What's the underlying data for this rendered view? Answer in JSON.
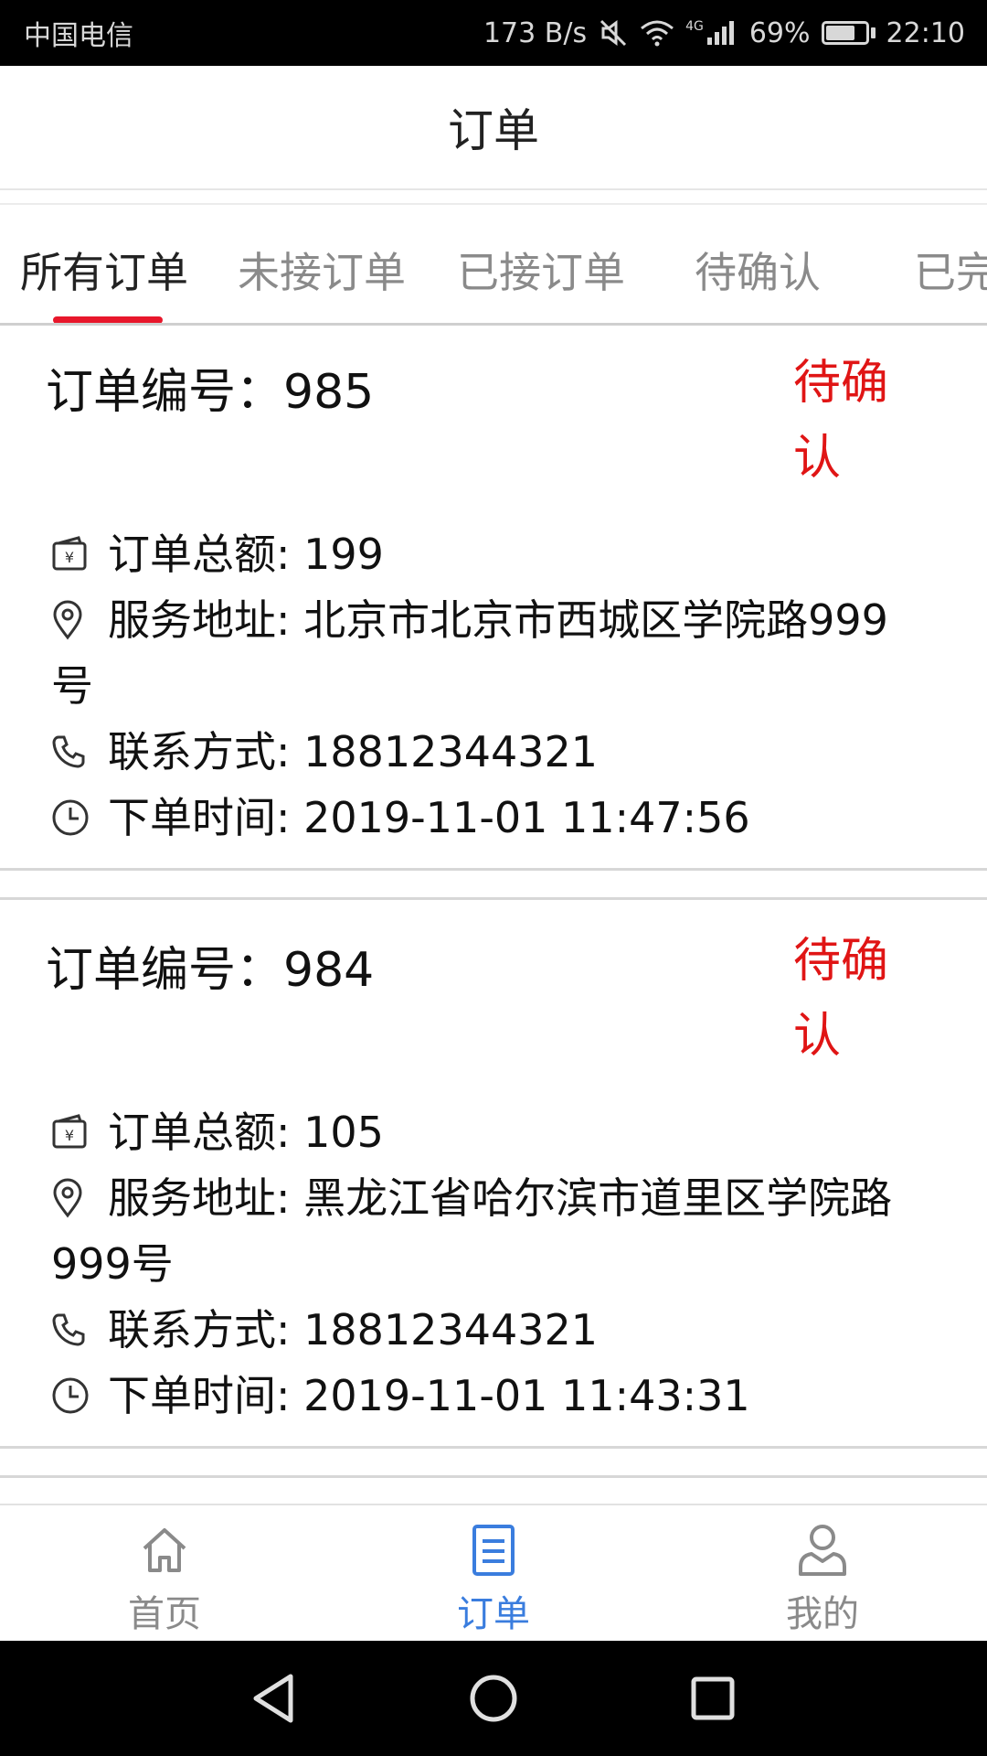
{
  "status_bar": {
    "carrier": "中国电信",
    "net_speed": "173 B/s",
    "network_type": "4G",
    "battery": "69%",
    "time": "22:10"
  },
  "header": {
    "title": "订单"
  },
  "tabs": [
    {
      "label": "所有订单",
      "active": true
    },
    {
      "label": "未接订单",
      "active": false
    },
    {
      "label": "已接订单",
      "active": false
    },
    {
      "label": "待确认",
      "active": false
    },
    {
      "label": "已完",
      "active": false
    }
  ],
  "orders": [
    {
      "order_no": "订单编号：985",
      "status": "待确认",
      "amount": "订单总额: 199",
      "address": "服务地址: 北京市北京市西城区学院路999号",
      "phone": "联系方式: 18812344321",
      "time": "下单时间: 2019-11-01 11:47:56"
    },
    {
      "order_no": "订单编号：984",
      "status": "待确认",
      "amount": "订单总额: 105",
      "address": "服务地址: 黑龙江省哈尔滨市道里区学院路999号",
      "phone": "联系方式: 18812344321",
      "time": "下单时间: 2019-11-01 11:43:31"
    }
  ],
  "bottom_nav": [
    {
      "label": "首页",
      "icon": "home-icon",
      "active": false
    },
    {
      "label": "订单",
      "icon": "document-icon",
      "active": true
    },
    {
      "label": "我的",
      "icon": "person-icon",
      "active": false
    }
  ],
  "colors": {
    "accent_red": "#e01515",
    "tab_indicator": "#e8172b",
    "nav_active": "#3a7dde"
  }
}
